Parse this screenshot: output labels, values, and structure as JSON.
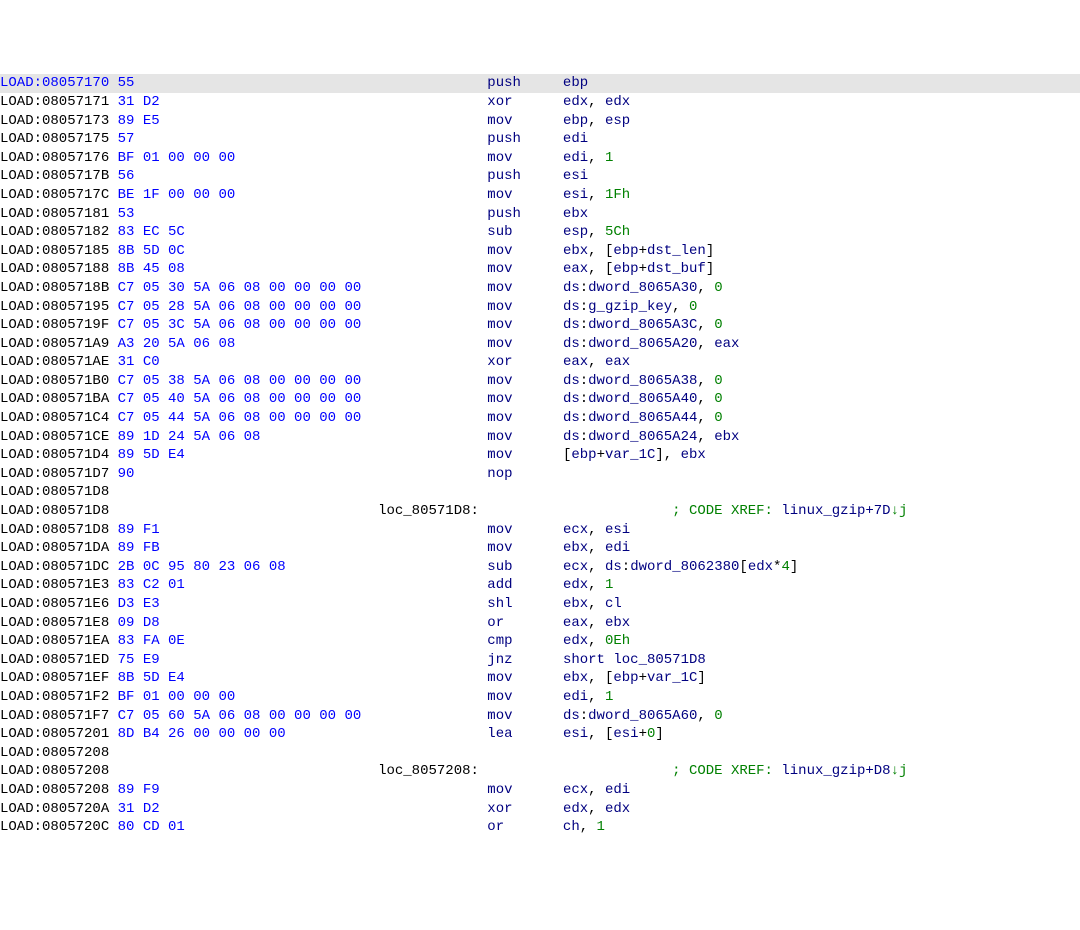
{
  "view": {
    "segment_label": "LOAD",
    "columns": {
      "addr_end": 14,
      "bytes_start": 15,
      "bytes_width": 30,
      "label_start": 45,
      "mnemonic_start": 58,
      "operand_start": 67,
      "comment_start": 80
    }
  },
  "lines": [
    {
      "kind": "instr",
      "addr": "08057170",
      "addr_hl": true,
      "row_hl": true,
      "bytes": "55",
      "mnemonic": "push",
      "operands": [
        {
          "t": "reg",
          "v": "ebp"
        }
      ]
    },
    {
      "kind": "instr",
      "addr": "08057171",
      "bytes": "31 D2",
      "mnemonic": "xor",
      "operands": [
        {
          "t": "reg",
          "v": "edx"
        },
        {
          "t": "punct",
          "v": ", "
        },
        {
          "t": "reg",
          "v": "edx"
        }
      ]
    },
    {
      "kind": "instr",
      "addr": "08057173",
      "bytes": "89 E5",
      "mnemonic": "mov",
      "operands": [
        {
          "t": "reg",
          "v": "ebp"
        },
        {
          "t": "punct",
          "v": ", "
        },
        {
          "t": "reg",
          "v": "esp"
        }
      ]
    },
    {
      "kind": "instr",
      "addr": "08057175",
      "bytes": "57",
      "mnemonic": "push",
      "operands": [
        {
          "t": "reg",
          "v": "edi"
        }
      ]
    },
    {
      "kind": "instr",
      "addr": "08057176",
      "bytes": "BF 01 00 00 00",
      "mnemonic": "mov",
      "operands": [
        {
          "t": "reg",
          "v": "edi"
        },
        {
          "t": "punct",
          "v": ", "
        },
        {
          "t": "imm",
          "v": "1"
        }
      ]
    },
    {
      "kind": "instr",
      "addr": "0805717B",
      "bytes": "56",
      "mnemonic": "push",
      "operands": [
        {
          "t": "reg",
          "v": "esi"
        }
      ]
    },
    {
      "kind": "instr",
      "addr": "0805717C",
      "bytes": "BE 1F 00 00 00",
      "mnemonic": "mov",
      "operands": [
        {
          "t": "reg",
          "v": "esi"
        },
        {
          "t": "punct",
          "v": ", "
        },
        {
          "t": "imm",
          "v": "1Fh"
        }
      ]
    },
    {
      "kind": "instr",
      "addr": "08057181",
      "bytes": "53",
      "mnemonic": "push",
      "operands": [
        {
          "t": "reg",
          "v": "ebx"
        }
      ]
    },
    {
      "kind": "instr",
      "addr": "08057182",
      "bytes": "83 EC 5C",
      "mnemonic": "sub",
      "operands": [
        {
          "t": "reg",
          "v": "esp"
        },
        {
          "t": "punct",
          "v": ", "
        },
        {
          "t": "imm",
          "v": "5Ch"
        }
      ]
    },
    {
      "kind": "instr",
      "addr": "08057185",
      "bytes": "8B 5D 0C",
      "mnemonic": "mov",
      "operands": [
        {
          "t": "reg",
          "v": "ebx"
        },
        {
          "t": "punct",
          "v": ", ["
        },
        {
          "t": "reg",
          "v": "ebp"
        },
        {
          "t": "punct",
          "v": "+"
        },
        {
          "t": "identifier",
          "v": "dst_len"
        },
        {
          "t": "punct",
          "v": "]"
        }
      ]
    },
    {
      "kind": "instr",
      "addr": "08057188",
      "bytes": "8B 45 08",
      "mnemonic": "mov",
      "operands": [
        {
          "t": "reg",
          "v": "eax"
        },
        {
          "t": "punct",
          "v": ", ["
        },
        {
          "t": "reg",
          "v": "ebp"
        },
        {
          "t": "punct",
          "v": "+"
        },
        {
          "t": "identifier",
          "v": "dst_buf"
        },
        {
          "t": "punct",
          "v": "]"
        }
      ]
    },
    {
      "kind": "instr",
      "addr": "0805718B",
      "bytes": "C7 05 30 5A 06 08 00 00 00 00",
      "mnemonic": "mov",
      "operands": [
        {
          "t": "reg",
          "v": "ds"
        },
        {
          "t": "punct",
          "v": ":"
        },
        {
          "t": "identifier",
          "v": "dword_8065A30"
        },
        {
          "t": "punct",
          "v": ", "
        },
        {
          "t": "imm",
          "v": "0"
        }
      ]
    },
    {
      "kind": "instr",
      "addr": "08057195",
      "bytes": "C7 05 28 5A 06 08 00 00 00 00",
      "mnemonic": "mov",
      "operands": [
        {
          "t": "reg",
          "v": "ds"
        },
        {
          "t": "punct",
          "v": ":"
        },
        {
          "t": "identifier",
          "v": "g_gzip_key"
        },
        {
          "t": "punct",
          "v": ", "
        },
        {
          "t": "imm",
          "v": "0"
        }
      ]
    },
    {
      "kind": "instr",
      "addr": "0805719F",
      "bytes": "C7 05 3C 5A 06 08 00 00 00 00",
      "mnemonic": "mov",
      "operands": [
        {
          "t": "reg",
          "v": "ds"
        },
        {
          "t": "punct",
          "v": ":"
        },
        {
          "t": "identifier",
          "v": "dword_8065A3C"
        },
        {
          "t": "punct",
          "v": ", "
        },
        {
          "t": "imm",
          "v": "0"
        }
      ]
    },
    {
      "kind": "instr",
      "addr": "080571A9",
      "bytes": "A3 20 5A 06 08",
      "mnemonic": "mov",
      "operands": [
        {
          "t": "reg",
          "v": "ds"
        },
        {
          "t": "punct",
          "v": ":"
        },
        {
          "t": "identifier",
          "v": "dword_8065A20"
        },
        {
          "t": "punct",
          "v": ", "
        },
        {
          "t": "reg",
          "v": "eax"
        }
      ]
    },
    {
      "kind": "instr",
      "addr": "080571AE",
      "bytes": "31 C0",
      "mnemonic": "xor",
      "operands": [
        {
          "t": "reg",
          "v": "eax"
        },
        {
          "t": "punct",
          "v": ", "
        },
        {
          "t": "reg",
          "v": "eax"
        }
      ]
    },
    {
      "kind": "instr",
      "addr": "080571B0",
      "bytes": "C7 05 38 5A 06 08 00 00 00 00",
      "mnemonic": "mov",
      "operands": [
        {
          "t": "reg",
          "v": "ds"
        },
        {
          "t": "punct",
          "v": ":"
        },
        {
          "t": "identifier",
          "v": "dword_8065A38"
        },
        {
          "t": "punct",
          "v": ", "
        },
        {
          "t": "imm",
          "v": "0"
        }
      ]
    },
    {
      "kind": "instr",
      "addr": "080571BA",
      "bytes": "C7 05 40 5A 06 08 00 00 00 00",
      "mnemonic": "mov",
      "operands": [
        {
          "t": "reg",
          "v": "ds"
        },
        {
          "t": "punct",
          "v": ":"
        },
        {
          "t": "identifier",
          "v": "dword_8065A40"
        },
        {
          "t": "punct",
          "v": ", "
        },
        {
          "t": "imm",
          "v": "0"
        }
      ]
    },
    {
      "kind": "instr",
      "addr": "080571C4",
      "bytes": "C7 05 44 5A 06 08 00 00 00 00",
      "mnemonic": "mov",
      "operands": [
        {
          "t": "reg",
          "v": "ds"
        },
        {
          "t": "punct",
          "v": ":"
        },
        {
          "t": "identifier",
          "v": "dword_8065A44"
        },
        {
          "t": "punct",
          "v": ", "
        },
        {
          "t": "imm",
          "v": "0"
        }
      ]
    },
    {
      "kind": "instr",
      "addr": "080571CE",
      "bytes": "89 1D 24 5A 06 08",
      "mnemonic": "mov",
      "operands": [
        {
          "t": "reg",
          "v": "ds"
        },
        {
          "t": "punct",
          "v": ":"
        },
        {
          "t": "identifier",
          "v": "dword_8065A24"
        },
        {
          "t": "punct",
          "v": ", "
        },
        {
          "t": "reg",
          "v": "ebx"
        }
      ]
    },
    {
      "kind": "instr",
      "addr": "080571D4",
      "bytes": "89 5D E4",
      "mnemonic": "mov",
      "operands": [
        {
          "t": "punct",
          "v": "["
        },
        {
          "t": "reg",
          "v": "ebp"
        },
        {
          "t": "punct",
          "v": "+"
        },
        {
          "t": "identifier",
          "v": "var_1C"
        },
        {
          "t": "punct",
          "v": "], "
        },
        {
          "t": "reg",
          "v": "ebx"
        }
      ]
    },
    {
      "kind": "instr",
      "addr": "080571D7",
      "bytes": "90",
      "mnemonic": "nop",
      "operands": []
    },
    {
      "kind": "blank",
      "addr": "080571D8"
    },
    {
      "kind": "label",
      "addr": "080571D8",
      "label": "loc_80571D8:",
      "comment": {
        "prefix": "; CODE XREF: ",
        "sym": "linux_gzip+7D",
        "suffix": "↓j"
      }
    },
    {
      "kind": "instr",
      "addr": "080571D8",
      "bytes": "89 F1",
      "mnemonic": "mov",
      "operands": [
        {
          "t": "reg",
          "v": "ecx"
        },
        {
          "t": "punct",
          "v": ", "
        },
        {
          "t": "reg",
          "v": "esi"
        }
      ]
    },
    {
      "kind": "instr",
      "addr": "080571DA",
      "bytes": "89 FB",
      "mnemonic": "mov",
      "operands": [
        {
          "t": "reg",
          "v": "ebx"
        },
        {
          "t": "punct",
          "v": ", "
        },
        {
          "t": "reg",
          "v": "edi"
        }
      ]
    },
    {
      "kind": "instr",
      "addr": "080571DC",
      "bytes": "2B 0C 95 80 23 06 08",
      "mnemonic": "sub",
      "operands": [
        {
          "t": "reg",
          "v": "ecx"
        },
        {
          "t": "punct",
          "v": ", "
        },
        {
          "t": "reg",
          "v": "ds"
        },
        {
          "t": "punct",
          "v": ":"
        },
        {
          "t": "identifier",
          "v": "dword_8062380"
        },
        {
          "t": "punct",
          "v": "["
        },
        {
          "t": "reg",
          "v": "edx"
        },
        {
          "t": "punct",
          "v": "*"
        },
        {
          "t": "imm",
          "v": "4"
        },
        {
          "t": "punct",
          "v": "]"
        }
      ]
    },
    {
      "kind": "instr",
      "addr": "080571E3",
      "bytes": "83 C2 01",
      "mnemonic": "add",
      "operands": [
        {
          "t": "reg",
          "v": "edx"
        },
        {
          "t": "punct",
          "v": ", "
        },
        {
          "t": "imm",
          "v": "1"
        }
      ]
    },
    {
      "kind": "instr",
      "addr": "080571E6",
      "bytes": "D3 E3",
      "mnemonic": "shl",
      "operands": [
        {
          "t": "reg",
          "v": "ebx"
        },
        {
          "t": "punct",
          "v": ", "
        },
        {
          "t": "reg",
          "v": "cl"
        }
      ]
    },
    {
      "kind": "instr",
      "addr": "080571E8",
      "bytes": "09 D8",
      "mnemonic": "or",
      "operands": [
        {
          "t": "reg",
          "v": "eax"
        },
        {
          "t": "punct",
          "v": ", "
        },
        {
          "t": "reg",
          "v": "ebx"
        }
      ]
    },
    {
      "kind": "instr",
      "addr": "080571EA",
      "bytes": "83 FA 0E",
      "mnemonic": "cmp",
      "operands": [
        {
          "t": "reg",
          "v": "edx"
        },
        {
          "t": "punct",
          "v": ", "
        },
        {
          "t": "imm",
          "v": "0Eh"
        }
      ]
    },
    {
      "kind": "instr",
      "addr": "080571ED",
      "bytes": "75 E9",
      "mnemonic": "jnz",
      "operands": [
        {
          "t": "reg",
          "v": "short"
        },
        {
          "t": "punct",
          "v": " "
        },
        {
          "t": "identifier",
          "v": "loc_80571D8"
        }
      ]
    },
    {
      "kind": "instr",
      "addr": "080571EF",
      "bytes": "8B 5D E4",
      "mnemonic": "mov",
      "operands": [
        {
          "t": "reg",
          "v": "ebx"
        },
        {
          "t": "punct",
          "v": ", ["
        },
        {
          "t": "reg",
          "v": "ebp"
        },
        {
          "t": "punct",
          "v": "+"
        },
        {
          "t": "identifier",
          "v": "var_1C"
        },
        {
          "t": "punct",
          "v": "]"
        }
      ]
    },
    {
      "kind": "instr",
      "addr": "080571F2",
      "bytes": "BF 01 00 00 00",
      "mnemonic": "mov",
      "operands": [
        {
          "t": "reg",
          "v": "edi"
        },
        {
          "t": "punct",
          "v": ", "
        },
        {
          "t": "imm",
          "v": "1"
        }
      ]
    },
    {
      "kind": "instr",
      "addr": "080571F7",
      "bytes": "C7 05 60 5A 06 08 00 00 00 00",
      "mnemonic": "mov",
      "operands": [
        {
          "t": "reg",
          "v": "ds"
        },
        {
          "t": "punct",
          "v": ":"
        },
        {
          "t": "identifier",
          "v": "dword_8065A60"
        },
        {
          "t": "punct",
          "v": ", "
        },
        {
          "t": "imm",
          "v": "0"
        }
      ]
    },
    {
      "kind": "instr",
      "addr": "08057201",
      "bytes": "8D B4 26 00 00 00 00",
      "mnemonic": "lea",
      "operands": [
        {
          "t": "reg",
          "v": "esi"
        },
        {
          "t": "punct",
          "v": ", ["
        },
        {
          "t": "reg",
          "v": "esi"
        },
        {
          "t": "punct",
          "v": "+"
        },
        {
          "t": "imm",
          "v": "0"
        },
        {
          "t": "punct",
          "v": "]"
        }
      ]
    },
    {
      "kind": "blank",
      "addr": "08057208"
    },
    {
      "kind": "label",
      "addr": "08057208",
      "label": "loc_8057208:",
      "comment": {
        "prefix": "; CODE XREF: ",
        "sym": "linux_gzip+D8",
        "suffix": "↓j"
      }
    },
    {
      "kind": "instr",
      "addr": "08057208",
      "bytes": "89 F9",
      "mnemonic": "mov",
      "operands": [
        {
          "t": "reg",
          "v": "ecx"
        },
        {
          "t": "punct",
          "v": ", "
        },
        {
          "t": "reg",
          "v": "edi"
        }
      ]
    },
    {
      "kind": "instr",
      "addr": "0805720A",
      "bytes": "31 D2",
      "mnemonic": "xor",
      "operands": [
        {
          "t": "reg",
          "v": "edx"
        },
        {
          "t": "punct",
          "v": ", "
        },
        {
          "t": "reg",
          "v": "edx"
        }
      ]
    },
    {
      "kind": "instr",
      "addr": "0805720C",
      "bytes": "80 CD 01",
      "mnemonic": "or",
      "operands": [
        {
          "t": "reg",
          "v": "ch"
        },
        {
          "t": "punct",
          "v": ", "
        },
        {
          "t": "imm",
          "v": "1"
        }
      ]
    }
  ]
}
